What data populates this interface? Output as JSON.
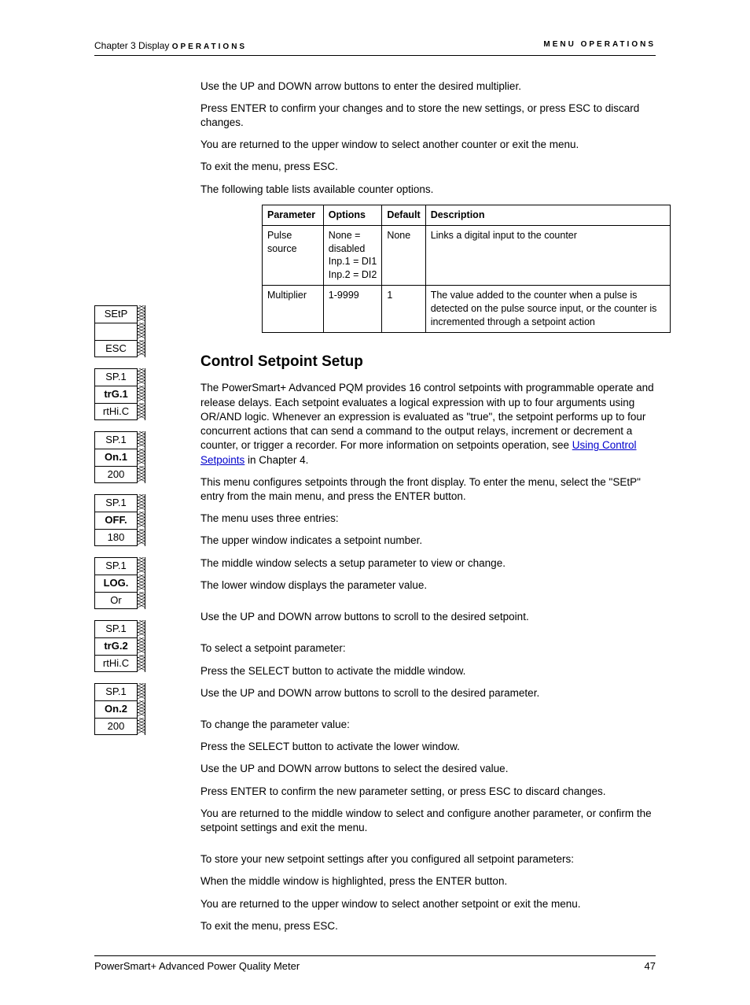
{
  "header": {
    "left_prefix": "Chapter 3  Display ",
    "left_spaced": "OPERATIONS",
    "right": "MENU OPERATIONS"
  },
  "intro_paragraphs": [
    "Use the UP and DOWN arrow buttons to enter the desired multiplier.",
    "Press ENTER to confirm your changes and to store the new settings, or press ESC to discard changes.",
    "You are returned to the upper window to select another counter or exit the menu.",
    "To exit the menu, press ESC.",
    "The following table lists available counter options."
  ],
  "table": {
    "headers": [
      "Parameter",
      "Options",
      "Default",
      "Description"
    ],
    "rows": [
      {
        "parameter": "Pulse source",
        "options": "None = disabled\nInp.1 = DI1\nInp.2 = DI2",
        "default": "None",
        "description": "Links a digital input to the counter"
      },
      {
        "parameter": "Multiplier",
        "options": "1-9999",
        "default": "1",
        "description": "The value added to the counter when a pulse is detected on the pulse source input, or the counter is incremented through a setpoint action"
      }
    ]
  },
  "section_title": "Control Setpoint Setup",
  "section_p1_before": "The PowerSmart+ Advanced PQM provides 16 control setpoints with programmable operate and release delays. Each setpoint evaluates a logical expression with up to four arguments using OR/AND logic. Whenever an expression is evaluated as \"true\", the setpoint performs up to four concurrent actions that can send a command to the output relays, increment or decrement a counter, or trigger a recorder. For more information on setpoints operation, see ",
  "section_p1_link": "Using Control Setpoints",
  "section_p1_after": " in Chapter 4.",
  "section_paragraphs": [
    "This menu configures setpoints through the front display. To enter the menu, select the \"SEtP\" entry from the main menu, and press the ENTER button.",
    "The menu uses three entries:",
    "The upper window indicates a setpoint number.",
    "The middle window selects a setup parameter to view or change.",
    "The lower window displays the parameter value."
  ],
  "section_spaced1": [
    "Use the UP and DOWN arrow buttons to scroll to the desired setpoint."
  ],
  "section_spaced2": [
    "To select a setpoint parameter:",
    "Press the SELECT button to activate the middle window.",
    "Use the UP and DOWN arrow buttons to scroll to the desired parameter."
  ],
  "section_spaced3": [
    "To change the parameter value:",
    "Press the SELECT button to activate the lower window.",
    "Use the UP and DOWN arrow buttons to select the desired value.",
    "Press ENTER to confirm the new parameter setting, or press ESC to discard changes.",
    "You are returned to the middle window to select and configure another parameter, or confirm the setpoint settings and exit the menu."
  ],
  "section_spaced4": [
    "To store your new setpoint settings after you configured all setpoint parameters:",
    "When the middle window is highlighted, press the ENTER button.",
    "You are returned to the upper window to select another setpoint or exit the menu.",
    "To exit the menu, press ESC."
  ],
  "footer": {
    "left": "PowerSmart+ Advanced Power Quality Meter",
    "right": "47"
  },
  "sidebar_groups": [
    [
      {
        "t": "SEtP"
      },
      {
        "t": ""
      },
      {
        "t": "ESC"
      }
    ],
    [
      {
        "t": "SP.1"
      },
      {
        "t": "trG.1",
        "b": true
      },
      {
        "t": "rtHi.C"
      }
    ],
    [
      {
        "t": "SP.1"
      },
      {
        "t": "On.1",
        "b": true
      },
      {
        "t": "200"
      }
    ],
    [
      {
        "t": "SP.1"
      },
      {
        "t": "OFF.",
        "b": true
      },
      {
        "t": "180"
      }
    ],
    [
      {
        "t": "SP.1"
      },
      {
        "t": "LOG.",
        "b": true
      },
      {
        "t": "Or"
      }
    ],
    [
      {
        "t": "SP.1"
      },
      {
        "t": "trG.2",
        "b": true
      },
      {
        "t": "rtHi.C"
      }
    ],
    [
      {
        "t": "SP.1"
      },
      {
        "t": "On.2",
        "b": true
      },
      {
        "t": "200"
      }
    ]
  ]
}
